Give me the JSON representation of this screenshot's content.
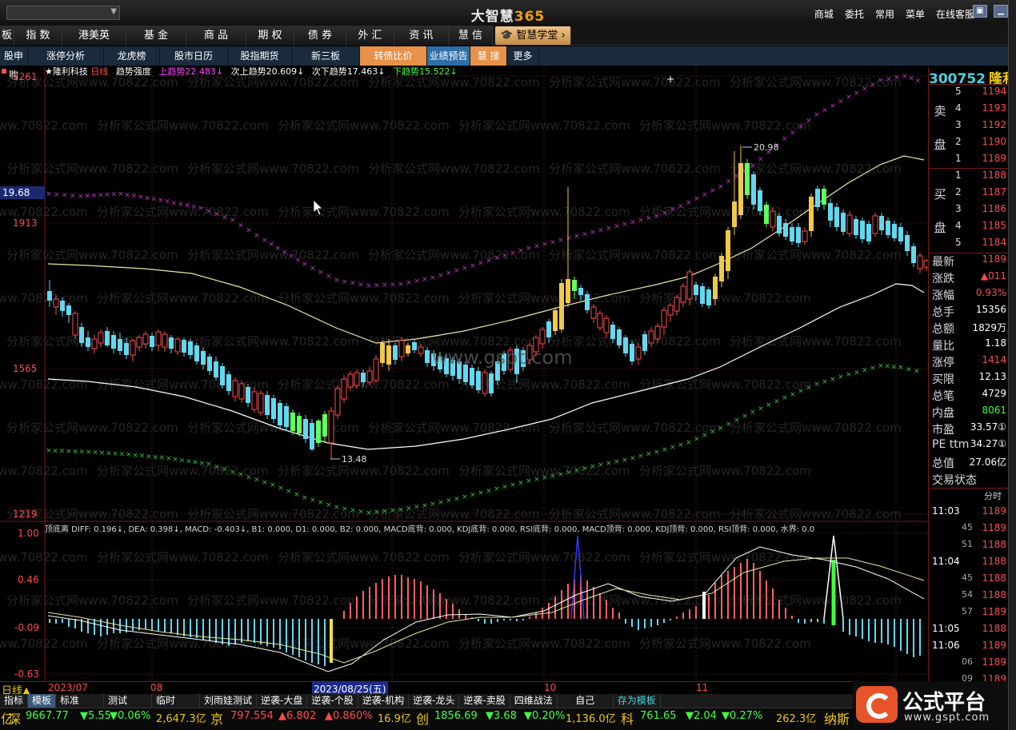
{
  "window": {
    "app_title": "大智慧",
    "app_title_num": "365",
    "top_links": [
      "商城",
      "委托",
      "常用",
      "菜单",
      "在线客服"
    ]
  },
  "menu1": [
    "板",
    "指 数",
    "港美英",
    "基 金",
    "商 品",
    "期 权",
    "债 券",
    "外 汇",
    "资 讯",
    "慧 信"
  ],
  "menu1_school": "智慧学堂",
  "menu2": [
    "股申购",
    "涨停分析",
    "龙虎榜",
    "股市日历",
    "股指期货",
    "新三板",
    "转债比价",
    "业绩预告",
    "慧 搜",
    "更多"
  ],
  "chart_header": {
    "stock": "★隆利科技",
    "period": "日线",
    "indicator": "趋势强度",
    "items": [
      {
        "label": "上趋势",
        "value": "22.483↓",
        "color": "#ff40ff"
      },
      {
        "label": "次上趋势",
        "value": "20.609↓",
        "color": "#ffffff"
      },
      {
        "label": "次下趋势",
        "value": "17.463↓",
        "color": "#ffffff"
      },
      {
        "label": "下趋势",
        "value": "15.522↓",
        "color": "#40ff40"
      }
    ]
  },
  "price_axis": [
    "2261",
    "1913",
    "1565",
    "1219"
  ],
  "crosshair_price": "19.68",
  "annotations": {
    "high": "20.98",
    "low": "13.48"
  },
  "watermark": "www.gspt.com",
  "bg_watermark": "分析家公式网www.70822.com",
  "macd_header": "顶底离 DIFF: 0.196↓, DEA: 0.398↓, MACD: -0.403↓, B1: 0.000, D1: 0.000, B2: 0.000, MACD底背: 0.000, KDJ底背: 0.000, RSI底背: 0.000, MACD顶背: 0.000, KDJ顶背: 0.000, RSI顶背: 0.000, 水界: 0.0",
  "macd_axis": [
    "1.00",
    "0.46",
    "-0.09",
    "-0.63"
  ],
  "date_axis": {
    "labels": [
      "2023/07",
      "08",
      "10",
      "11"
    ],
    "highlight": "2023/08/25(五)"
  },
  "right_panel": {
    "code": "300752",
    "name": "隆利",
    "sell": {
      "label_top": "卖",
      "label_bottom": "盘",
      "rows": [
        [
          "5",
          "1194"
        ],
        [
          "4",
          "1193"
        ],
        [
          "3",
          "1192"
        ],
        [
          "2",
          "1190"
        ],
        [
          "1",
          "1189"
        ]
      ]
    },
    "buy": {
      "label_top": "买",
      "label_bottom": "盘",
      "rows": [
        [
          "1",
          "1188"
        ],
        [
          "2",
          "1187"
        ],
        [
          "3",
          "1186"
        ],
        [
          "4",
          "1185"
        ],
        [
          "5",
          "1184"
        ]
      ]
    },
    "stats": [
      [
        "最新",
        "1189",
        "#ff4b4b"
      ],
      [
        "涨跌",
        "▲011",
        "#ff4b4b"
      ],
      [
        "涨幅",
        "0.93%",
        "#ff4b4b"
      ],
      [
        "总手",
        "15356",
        "#ffffff"
      ],
      [
        "总额",
        "1829万",
        "#ffffff"
      ],
      [
        "量比",
        "1.18",
        "#ffffff"
      ],
      [
        "涨停",
        "1414",
        "#ff4b4b"
      ],
      [
        "买限",
        "12.13",
        "#ffffff"
      ],
      [
        "总笔",
        "4729",
        "#ffffff"
      ],
      [
        "内盘",
        "8061",
        "#40ff40"
      ],
      [
        "市盈",
        "33.57①",
        "#ffffff"
      ],
      [
        "PE ttm",
        "34.27①",
        "#ffffff"
      ],
      [
        "总值",
        "27.06亿",
        "#ffffff"
      ],
      [
        "交易状态",
        "",
        ""
      ]
    ],
    "ticks_header": "分时",
    "ticks": [
      [
        "11:03",
        "1189"
      ],
      [
        "45",
        "1189"
      ],
      [
        "51",
        "1188"
      ],
      [
        "11:04",
        "1188"
      ],
      [
        "45",
        "1188"
      ],
      [
        "54",
        "1188"
      ],
      [
        "57",
        "1189"
      ],
      [
        "11:05",
        "1188"
      ],
      [
        "11:06",
        "1189"
      ],
      [
        "06",
        "1189"
      ],
      [
        "09",
        "1189"
      ]
    ]
  },
  "bottom_tabs": {
    "first": "日线▲",
    "items": [
      "指标",
      "模板",
      "标准",
      "测试",
      "临时",
      "刘雨娃测试",
      "逆袭-大盘",
      "逆袭-个股",
      "逆袭-机构",
      "逆袭-龙头",
      "逆袭-卖股",
      "四维战法",
      "自己",
      "存为模板"
    ]
  },
  "ticker": [
    {
      "text": "亿",
      "color": "#f0c800"
    },
    {
      "text": "深",
      "color": "#f0c800"
    },
    {
      "text": "9667.77",
      "color": "#40ff40"
    },
    {
      "text": "▼5.55",
      "color": "#40ff40"
    },
    {
      "text": "▼0.06%",
      "color": "#40ff40"
    },
    {
      "text": "2,647.3亿",
      "color": "#f0c800"
    },
    {
      "text": "京",
      "color": "#f0c800"
    },
    {
      "text": "797.554",
      "color": "#ff4b4b"
    },
    {
      "text": "▲6.802",
      "color": "#ff4b4b"
    },
    {
      "text": "▲0.860%",
      "color": "#ff4b4b"
    },
    {
      "text": "16.9亿",
      "color": "#f0c800"
    },
    {
      "text": "创",
      "color": "#f0c800"
    },
    {
      "text": "1856.69",
      "color": "#40ff40"
    },
    {
      "text": "▼3.68",
      "color": "#40ff40"
    },
    {
      "text": "▼0.20%",
      "color": "#40ff40"
    },
    {
      "text": "1,136.0亿",
      "color": "#f0c800"
    },
    {
      "text": "科",
      "color": "#f0c800"
    },
    {
      "text": "761.65",
      "color": "#40ff40"
    },
    {
      "text": "▼2.04",
      "color": "#40ff40"
    },
    {
      "text": "▼0.27%",
      "color": "#40ff40"
    },
    {
      "text": "262.3亿",
      "color": "#f0c800"
    },
    {
      "text": "纳斯",
      "color": "#f0c800"
    }
  ],
  "logo": {
    "title": "公式平台",
    "url": "www.gspt.com"
  }
}
